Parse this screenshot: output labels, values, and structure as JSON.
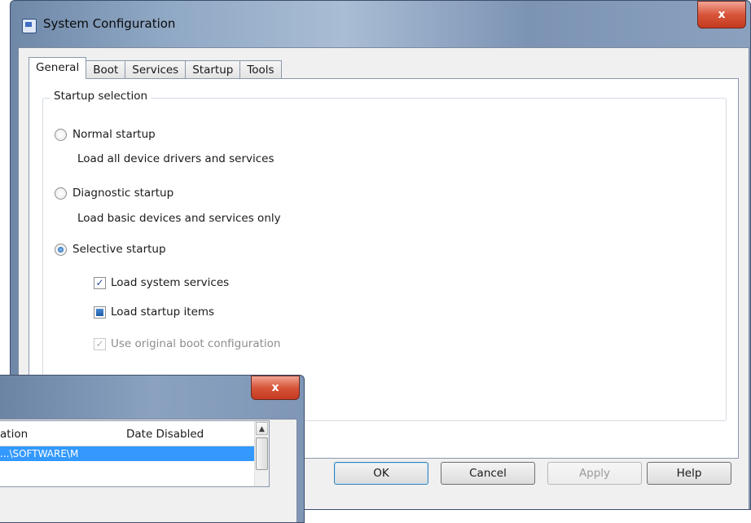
{
  "window": {
    "title": "System Configuration",
    "close_label": "x"
  },
  "tabs": [
    {
      "label": "General",
      "active": true
    },
    {
      "label": "Boot"
    },
    {
      "label": "Services"
    },
    {
      "label": "Startup"
    },
    {
      "label": "Tools"
    }
  ],
  "general": {
    "group_label": "Startup selection",
    "normal": {
      "label": "Normal startup",
      "desc": "Load all device drivers and services",
      "checked": false
    },
    "diagnostic": {
      "label": "Diagnostic startup",
      "desc": "Load basic devices and services only",
      "checked": false
    },
    "selective": {
      "label": "Selective startup",
      "checked": true
    },
    "options": {
      "load_system_services": {
        "label": "Load system services",
        "state": "checked"
      },
      "load_startup_items": {
        "label": "Load startup items",
        "state": "indeterminate"
      },
      "use_original_boot": {
        "label": "Use original boot configuration",
        "state": "checked-disabled"
      }
    }
  },
  "buttons": {
    "ok": "OK",
    "cancel": "Cancel",
    "apply": "Apply",
    "help": "Help"
  },
  "secondary_window": {
    "close_label": "x",
    "list": {
      "col_location": "ation",
      "col_date": "Date Disabled",
      "selected_row": "...\\SOFTWARE\\M"
    }
  }
}
